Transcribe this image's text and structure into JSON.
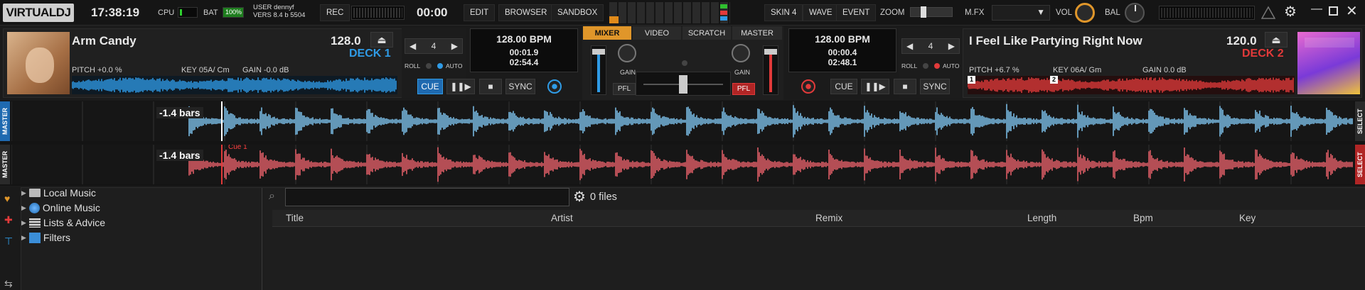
{
  "app": {
    "logo": "VIRTUALDJ",
    "clock": "17:38:19"
  },
  "topbar": {
    "cpu_label": "CPU",
    "bat_label": "BAT",
    "bat_value": "100%",
    "user_line": "USER  dennyf",
    "vers_line": "VERS  8.4 b 5504",
    "rec_label": "REC",
    "rec_time": "00:00",
    "edit_label": "EDIT",
    "browser_label": "BROWSER",
    "sandbox_label": "SANDBOX",
    "skin_label": "SKIN 4",
    "wave_label": "WAVE",
    "event_label": "EVENT",
    "zoom_label": "ZOOM",
    "mfx_label": "M.FX",
    "vol_label": "VOL",
    "bal_label": "BAL"
  },
  "deck1": {
    "title": "Arm Candy",
    "bpm": "128.0",
    "label": "DECK 1",
    "pitch": "PITCH  +0.0 %",
    "key": "KEY  05A/ Cm",
    "gain": "GAIN  -0.0 dB",
    "loop": "4",
    "roll_label": "ROLL",
    "auto_label": "AUTO",
    "display_bpm": "128.00 BPM",
    "elapsed": "00:01.9",
    "remain": "02:54.4",
    "cue_label": "CUE",
    "sync_label": "SYNC",
    "color": "#2f9be6"
  },
  "deck2": {
    "title": "I Feel Like Partying Right Now",
    "bpm": "120.0",
    "label": "DECK 2",
    "pitch": "PITCH  +6.7 %",
    "key": "KEY  06A/ Gm",
    "gain": "GAIN  0.0 dB",
    "loop": "4",
    "roll_label": "ROLL",
    "auto_label": "AUTO",
    "display_bpm": "128.00 BPM",
    "elapsed": "00:00.4",
    "remain": "02:48.1",
    "cue_label": "CUE",
    "sync_label": "SYNC",
    "cue_marker_1": "1",
    "cue_marker_2": "2",
    "color": "#e23a3a"
  },
  "mixer": {
    "tabs": [
      "MIXER",
      "VIDEO",
      "SCRATCH",
      "MASTER"
    ],
    "gain_label": "GAIN",
    "pfl_label": "PFL"
  },
  "scratch": {
    "deck1_bars": "-1.4 bars",
    "deck2_bars": "-1.4 bars",
    "cue_label": "Cue 1",
    "master_label": "MASTER",
    "select_label": "SELECT"
  },
  "browser": {
    "tree": [
      "Local Music",
      "Online Music",
      "Lists & Advice",
      "Filters"
    ],
    "search_placeholder": "",
    "file_count": "0 files",
    "columns": [
      "Title",
      "Artist",
      "Remix",
      "Length",
      "Bpm",
      "Key"
    ]
  }
}
